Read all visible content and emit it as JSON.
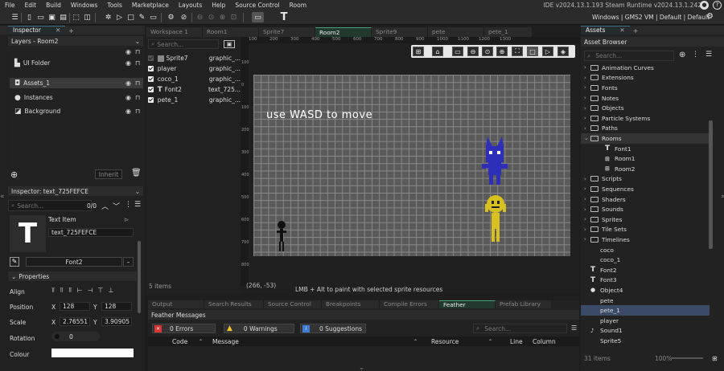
{
  "menu": [
    "File",
    "Edit",
    "Build",
    "Windows",
    "Tools",
    "Marketplace",
    "Layouts",
    "Help",
    "Source Control",
    "Room"
  ],
  "ide_version": "IDE v2024.13.1.193 Steam  Runtime v2024.13.1.242",
  "target_line": "Windows | GMS2 VM | Default | Default",
  "left": {
    "tab": "Inspector",
    "layers_title": "Layers - Room2",
    "layers": [
      {
        "name": "UI Folder",
        "icon": "folder-icon"
      },
      {
        "name": "Assets_1",
        "icon": "assets-layer-icon"
      },
      {
        "name": "Instances",
        "icon": "instances-layer-icon"
      },
      {
        "name": "Background",
        "icon": "background-layer-icon"
      }
    ],
    "inherit": "Inherit",
    "inspector_title": "Inspector: text_725FEFCE",
    "search_placeholder": "Search...",
    "page_count": "0/0",
    "item_type": "Text Item",
    "item_name": "text_725FEFCE",
    "font": "Font2",
    "properties_title": "Properties",
    "align_label": "Align",
    "position_label": "Position",
    "pos_x": "128",
    "pos_y": "128",
    "scale_label": "Scale",
    "scale_x": "2.76551",
    "scale_y": "3.90905",
    "rotation_label": "Rotation",
    "rotation": "0",
    "colour_label": "Colour",
    "colour_value": "#ffffff"
  },
  "workspace": {
    "tabs": [
      "Workspace 1",
      "Room1",
      "Sprite7",
      "Room2",
      "Sprite9",
      "pete",
      "pete_1"
    ],
    "active": "Room2"
  },
  "room": {
    "search_placeholder": "Search...",
    "assets": [
      {
        "name": "Sprite7",
        "res": "graphic_..."
      },
      {
        "name": "player",
        "res": "graphic_..."
      },
      {
        "name": "coco_1",
        "res": "graphic_..."
      },
      {
        "name": "Font2",
        "res": "text_725..."
      },
      {
        "name": "pete_1",
        "res": "graphic_..."
      }
    ],
    "items_count": "5 items",
    "canvas_text": "use WASD to move",
    "coords": "(266, -53)",
    "hint": "LMB + Alt to paint with selected sprite resources",
    "ruler_top": [
      "100",
      "200",
      "300",
      "400",
      "500",
      "600",
      "700",
      "800",
      "900",
      "1000",
      "1100",
      "1200",
      "1300"
    ],
    "ruler_left": [
      "100",
      "0",
      "100",
      "200",
      "300",
      "400",
      "500",
      "600",
      "700",
      "800"
    ]
  },
  "bottom": {
    "tabs": [
      "Output",
      "Search Results",
      "Source Control",
      "Breakpoints",
      "Compile Errors",
      "Feather Messa...",
      "Prefab Library"
    ],
    "active": "Feather Messa...",
    "title": "Feather Messages",
    "errors": "0 Errors",
    "warnings": "0 Warnings",
    "suggestions": "0 Suggestions",
    "search_placeholder": "Search...",
    "cols": [
      "Code",
      "Message",
      "Resource",
      "Line",
      "Column"
    ]
  },
  "assets": {
    "tab": "Assets",
    "title": "Asset Browser",
    "search_placeholder": "Search...",
    "tree": [
      {
        "name": "Animation Curves",
        "type": "folder",
        "level": 0
      },
      {
        "name": "Extensions",
        "type": "folder",
        "level": 0
      },
      {
        "name": "Fonts",
        "type": "folder",
        "level": 0
      },
      {
        "name": "Notes",
        "type": "folder",
        "level": 0
      },
      {
        "name": "Objects",
        "type": "folder",
        "level": 0
      },
      {
        "name": "Particle Systems",
        "type": "folder",
        "level": 0
      },
      {
        "name": "Paths",
        "type": "folder",
        "level": 0
      },
      {
        "name": "Rooms",
        "type": "open",
        "level": 0
      },
      {
        "name": "Font1",
        "type": "font",
        "level": 1
      },
      {
        "name": "Room1",
        "type": "room",
        "level": 1
      },
      {
        "name": "Room2",
        "type": "room",
        "level": 1
      },
      {
        "name": "Scripts",
        "type": "folder",
        "level": 0
      },
      {
        "name": "Sequences",
        "type": "folder",
        "level": 0
      },
      {
        "name": "Shaders",
        "type": "folder",
        "level": 0
      },
      {
        "name": "Sounds",
        "type": "folder",
        "level": 0
      },
      {
        "name": "Sprites",
        "type": "folder",
        "level": 0
      },
      {
        "name": "Tile Sets",
        "type": "folder",
        "level": 0
      },
      {
        "name": "Timelines",
        "type": "folder",
        "level": 0
      },
      {
        "name": "coco",
        "type": "sprite",
        "level": 0
      },
      {
        "name": "coco_1",
        "type": "sprite",
        "level": 0
      },
      {
        "name": "Font2",
        "type": "font",
        "level": 0
      },
      {
        "name": "Font3",
        "type": "font",
        "level": 0
      },
      {
        "name": "Object4",
        "type": "object",
        "level": 0
      },
      {
        "name": "pete",
        "type": "sprite",
        "level": 0
      },
      {
        "name": "pete_1",
        "type": "sprite",
        "level": 0
      },
      {
        "name": "player",
        "type": "sprite",
        "level": 0
      },
      {
        "name": "Sound1",
        "type": "sound",
        "level": 0
      },
      {
        "name": "Sprite5",
        "type": "sprite",
        "level": 0
      }
    ],
    "selected": "pete_1",
    "count": "31 items",
    "zoom": "100%"
  },
  "colors": {
    "accent": "#3d6e8a",
    "selected": "#3b4a66",
    "room_bg": "#5c5c5c"
  }
}
